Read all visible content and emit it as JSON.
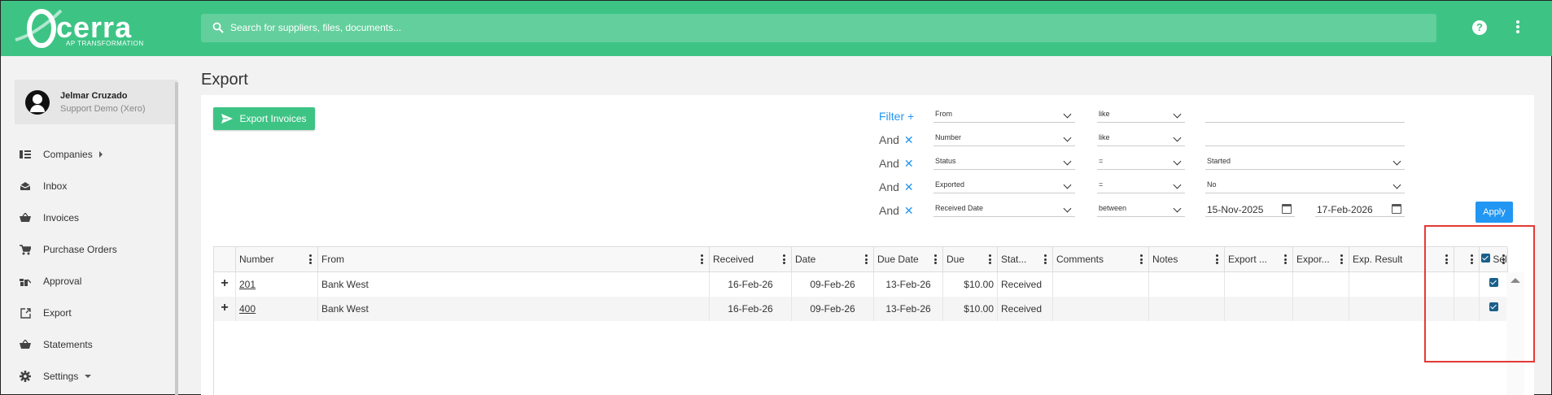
{
  "header": {
    "logo_text": "cerra",
    "logo_sub": "AP TRANSFORMATION",
    "search_placeholder": "Search for suppliers, files, documents..."
  },
  "user": {
    "name": "Jelmar Cruzado",
    "org": "Support Demo (Xero)"
  },
  "sidebar": {
    "items": [
      {
        "label": "Companies",
        "icon": "companies-icon"
      },
      {
        "label": "Inbox",
        "icon": "inbox-icon"
      },
      {
        "label": "Invoices",
        "icon": "basket-icon"
      },
      {
        "label": "Purchase Orders",
        "icon": "cart-icon"
      },
      {
        "label": "Approval",
        "icon": "approval-icon"
      },
      {
        "label": "Export",
        "icon": "export-icon"
      },
      {
        "label": "Statements",
        "icon": "basket-icon"
      },
      {
        "label": "Settings",
        "icon": "gear-icon"
      }
    ]
  },
  "page": {
    "title": "Export",
    "export_button": "Export Invoices",
    "apply_button": "Apply"
  },
  "filters": [
    {
      "prefix": "Filter",
      "field": "From",
      "op": "like",
      "value": ""
    },
    {
      "prefix": "And",
      "field": "Number",
      "op": "like",
      "value": ""
    },
    {
      "prefix": "And",
      "field": "Status",
      "op": "=",
      "value": "Started"
    },
    {
      "prefix": "And",
      "field": "Exported",
      "op": "=",
      "value": "No"
    },
    {
      "prefix": "And",
      "field": "Received Date",
      "op": "between",
      "value": "15-Nov-2025",
      "value2": "17-Feb-2026"
    }
  ],
  "table": {
    "columns": [
      "Number",
      "From",
      "Received",
      "Date",
      "Due Date",
      "Due",
      "Stat...",
      "Comments",
      "Notes",
      "Export ...",
      "Expor...",
      "Exp. Result",
      "",
      "Sel."
    ],
    "rows": [
      {
        "number": "201",
        "from": "Bank West",
        "received": "16-Feb-26",
        "date": "09-Feb-26",
        "due_date": "13-Feb-26",
        "due": "$10.00",
        "status": "Received",
        "selected": true
      },
      {
        "number": "400",
        "from": "Bank West",
        "received": "16-Feb-26",
        "date": "09-Feb-26",
        "due_date": "13-Feb-26",
        "due": "$10.00",
        "status": "Received",
        "selected": true
      }
    ]
  }
}
